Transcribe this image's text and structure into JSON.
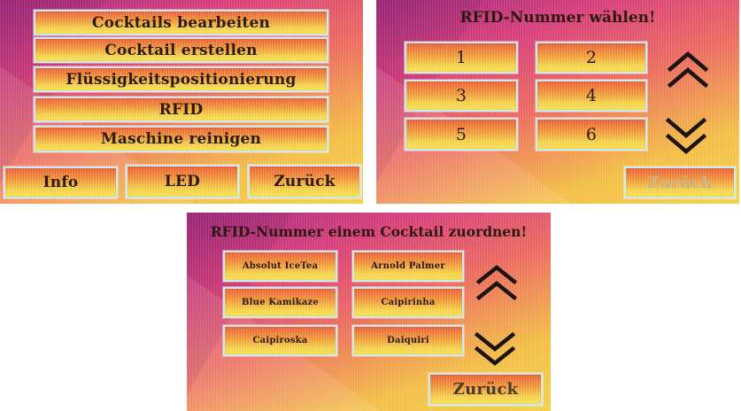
{
  "panels": {
    "menu": {
      "buttons": [
        "Cocktails bearbeiten",
        "Cocktail erstellen",
        "Flüssigkeitspositionierung",
        "RFID",
        "Maschine reinigen"
      ],
      "bottom_buttons": [
        "Info",
        "LED",
        "Zurück"
      ]
    },
    "rfid_select": {
      "title": "RFID-Nummer wählen!",
      "numbers": [
        "1",
        "2",
        "3",
        "4",
        "5",
        "6"
      ],
      "back_label": "Zurück"
    },
    "rfid_assign": {
      "title": "RFID-Nummer einem Cocktail zuordnen!",
      "cocktails": [
        "Absolut IceTea",
        "Arnold Palmer",
        "Blue Kamikaze",
        "Caipirinha",
        "Caipiroska",
        "Daiquiri"
      ],
      "back_label": "Zurück"
    }
  },
  "icons": {
    "scroll_up": "double-chevron-up-icon",
    "scroll_down": "double-chevron-down-icon"
  },
  "colors": {
    "button_top": "#ec5a2e",
    "button_bottom": "#fbe24a",
    "button_border": "#cfe9ef",
    "background_top": "#a0247c",
    "background_bottom": "#f6d24a"
  }
}
